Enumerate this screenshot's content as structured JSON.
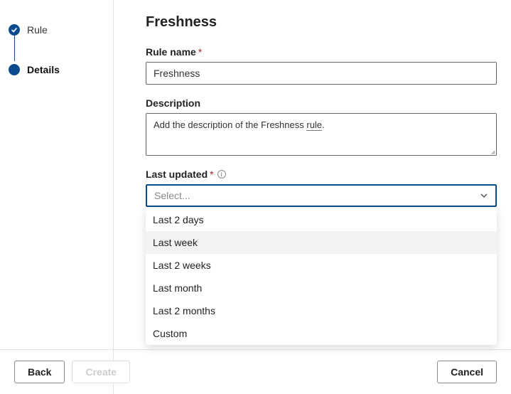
{
  "sidebar": {
    "steps": [
      {
        "label": "Rule",
        "state": "done"
      },
      {
        "label": "Details",
        "state": "active"
      }
    ]
  },
  "page": {
    "title": "Freshness"
  },
  "form": {
    "rule_name": {
      "label": "Rule name",
      "value": "Freshness",
      "required": true
    },
    "description": {
      "label": "Description",
      "value_prefix": "Add the description of the Freshness ",
      "value_underlined": "rule",
      "value_suffix": "."
    },
    "last_updated": {
      "label": "Last updated",
      "required": true,
      "placeholder": "Select...",
      "options": [
        "Last 2 days",
        "Last week",
        "Last 2 weeks",
        "Last month",
        "Last 2 months",
        "Custom"
      ],
      "hovered_index": 1
    }
  },
  "footer": {
    "back": "Back",
    "create": "Create",
    "cancel": "Cancel"
  },
  "icons": {
    "checkmark": "check-icon",
    "chevron": "chevron-down-icon",
    "info": "i"
  }
}
